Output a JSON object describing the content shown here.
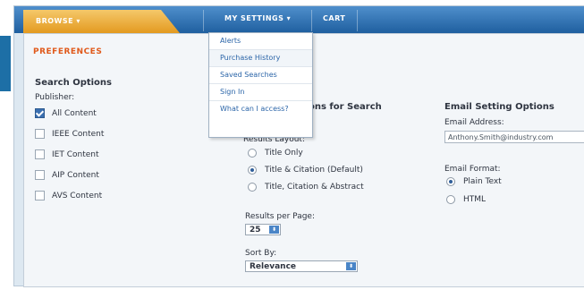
{
  "nav": {
    "browse_label": "BROWSE ▾",
    "settings_label": "MY SETTINGS ▾",
    "cart_label": "CART"
  },
  "settings_menu": {
    "items": [
      {
        "label": "Alerts"
      },
      {
        "label": "Purchase History"
      },
      {
        "label": "Saved Searches"
      },
      {
        "label": "Sign In"
      },
      {
        "label": "What can I access?"
      }
    ]
  },
  "preferences": {
    "title": "PREFERENCES",
    "search_options": {
      "heading": "Search Options",
      "publisher_label": "Publisher:",
      "publishers": [
        {
          "label": "All Content",
          "checked": true
        },
        {
          "label": "IEEE Content",
          "checked": false
        },
        {
          "label": "IET Content",
          "checked": false
        },
        {
          "label": "AIP Content",
          "checked": false
        },
        {
          "label": "AVS Content",
          "checked": false
        }
      ]
    },
    "display_options": {
      "heading_partial": "ons for Search",
      "results_layout_label": "Results Layout:",
      "layouts": [
        {
          "label": "Title Only",
          "checked": false
        },
        {
          "label": "Title & Citation (Default)",
          "checked": true
        },
        {
          "label": "Title, Citation & Abstract",
          "checked": false
        }
      ],
      "results_per_page_label": "Results per Page:",
      "results_per_page_value": "25",
      "sort_by_label": "Sort By:",
      "sort_by_value": "Relevance"
    },
    "email_options": {
      "heading": "Email Setting Options",
      "address_label": "Email Address:",
      "address_value": "Anthony.Smith@industry.com",
      "format_label": "Email Format:",
      "formats": [
        {
          "label": "Plain Text",
          "checked": true
        },
        {
          "label": "HTML",
          "checked": false
        }
      ]
    }
  },
  "colors": {
    "nav_blue": "#2e6fb0",
    "browse_orange": "#e8a02a",
    "preferences_title": "#e05a1c",
    "link_blue": "#2b65a8"
  }
}
